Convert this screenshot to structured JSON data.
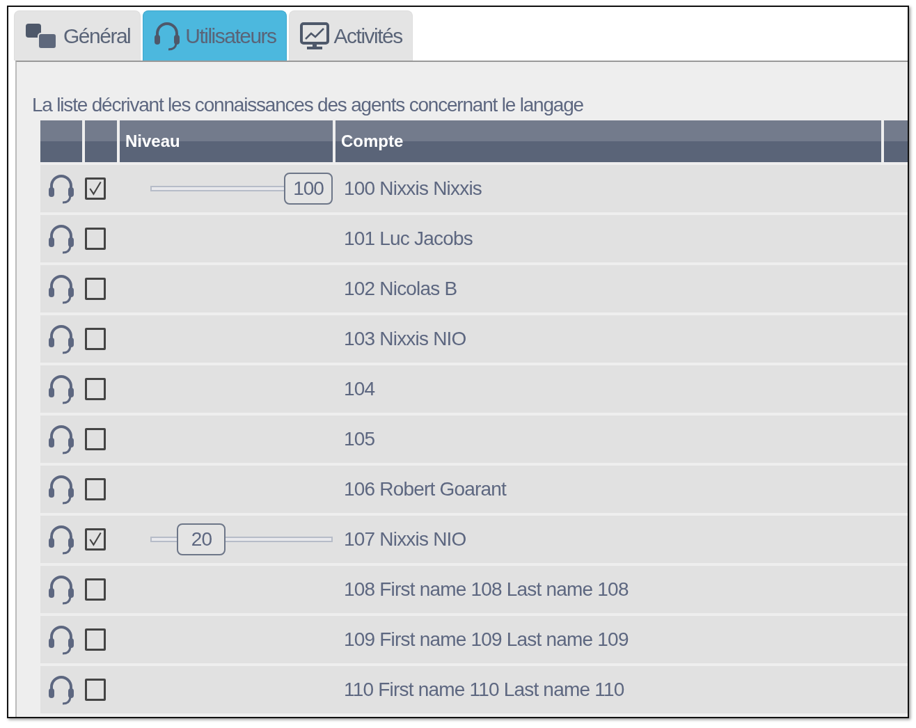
{
  "tabs": [
    {
      "label": "Général",
      "selected": false
    },
    {
      "label": "Utilisateurs",
      "selected": true
    },
    {
      "label": "Activités",
      "selected": false
    }
  ],
  "caption": "La liste décrivant les connaissances des agents concernant le langage",
  "table": {
    "columns": [
      "Niveau",
      "Compte"
    ],
    "rows": [
      {
        "checked": true,
        "level": 1,
        "reading": "100",
        "account": "100 Nixxis Nixxis"
      },
      {
        "checked": false,
        "account": "101 Luc Jacobs"
      },
      {
        "checked": false,
        "account": "102 Nicolas B"
      },
      {
        "checked": false,
        "account": "103 Nixxis NIO"
      },
      {
        "checked": false,
        "account": "104"
      },
      {
        "checked": false,
        "account": "105"
      },
      {
        "checked": false,
        "account": "106 Robert Goarant"
      },
      {
        "checked": true,
        "level": 0.2,
        "reading": "20",
        "account": "107 Nixxis NIO"
      },
      {
        "checked": false,
        "account": "108 First name 108 Last name 108"
      },
      {
        "checked": false,
        "account": "109 First name 109 Last name 109"
      },
      {
        "checked": false,
        "account": "110 First name 110 Last name 110"
      }
    ]
  }
}
